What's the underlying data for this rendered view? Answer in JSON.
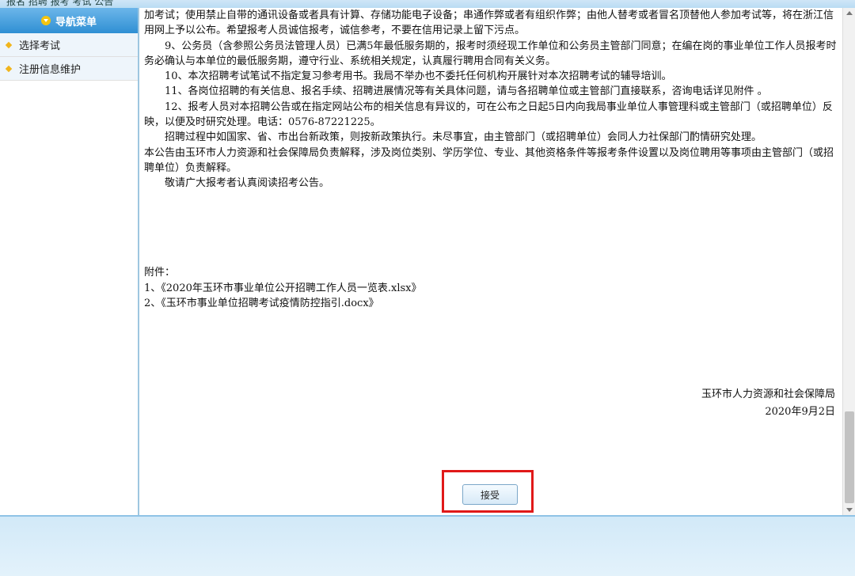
{
  "window": {
    "title_fragment": "报名 招聘 报考 考试 公告"
  },
  "sidebar": {
    "header": "导航菜单",
    "items": [
      {
        "label": "选择考试"
      },
      {
        "label": "注册信息维护"
      }
    ]
  },
  "document": {
    "paragraphs": [
      "加考试；使用禁止自带的通讯设备或者具有计算、存储功能电子设备；串通作弊或者有组织作弊；由他人替考或者冒名顶替他人参加考试等，将在浙江信用网上予以公布。希望报考人员诚信报考，诚信参考，不要在信用记录上留下污点。",
      "　　9、公务员（含参照公务员法管理人员）已满5年最低服务期的，报考时须经现工作单位和公务员主管部门同意；在编在岗的事业单位工作人员报考时务必确认与本单位的最低服务期，遵守行业、系统相关规定，认真履行聘用合同有关义务。",
      "　　10、本次招聘考试笔试不指定复习参考用书。我局不举办也不委托任何机构开展针对本次招聘考试的辅导培训。",
      "　　11、各岗位招聘的有关信息、报名手续、招聘进展情况等有关具体问题，请与各招聘单位或主管部门直接联系，咨询电话详见附件 。",
      "　　12、报考人员对本招聘公告或在指定网站公布的相关信息有异议的，可在公布之日起5日内向我局事业单位人事管理科或主管部门（或招聘单位）反映，以便及时研究处理。电话：0576-87221225。",
      "　　招聘过程中如国家、省、市出台新政策，则按新政策执行。未尽事宜，由主管部门（或招聘单位）会同人力社保部门酌情研究处理。",
      "本公告由玉环市人力资源和社会保障局负责解释，涉及岗位类别、学历学位、专业、其他资格条件等报考条件设置以及岗位聘用等事项由主管部门（或招聘单位）负责解释。",
      "　　敬请广大报考者认真阅读招考公告。"
    ],
    "attachments_title": "附件：",
    "attachments": [
      "1、《2020年玉环市事业单位公开招聘工作人员一览表.xlsx》",
      "2、《玉环市事业单位招聘考试疫情防控指引.docx》"
    ],
    "signature_org": "玉环市人力资源和社会保障局",
    "signature_date": "2020年9月2日"
  },
  "accept_button": "接受"
}
